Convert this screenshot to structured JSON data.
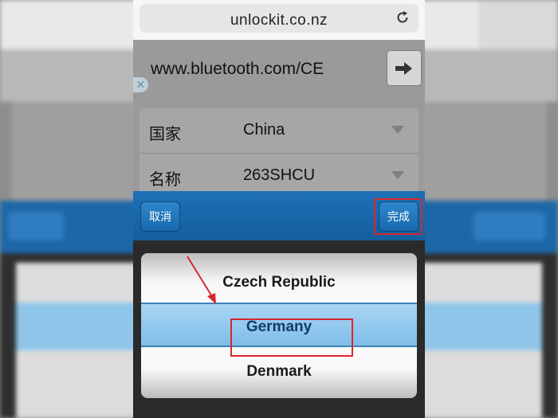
{
  "browser": {
    "address": "unlockit.co.nz",
    "reload_icon": "reload-icon"
  },
  "page": {
    "url_field_value": "www.bluetooth.com/CE",
    "go_icon": "arrow-right-icon",
    "close_icon": "close-icon",
    "form": {
      "rows": [
        {
          "label": "国家",
          "value": "China"
        },
        {
          "label": "名称",
          "value": "263SHCU"
        }
      ]
    }
  },
  "toolbar": {
    "cancel_label": "取消",
    "done_label": "完成"
  },
  "picker": {
    "options": [
      "Czech Republic",
      "Germany",
      "Denmark"
    ],
    "selected": "Germany"
  },
  "colors": {
    "toolbar": "#1968ad",
    "selection": "#8fc6ea",
    "annotation": "#d9272e"
  }
}
